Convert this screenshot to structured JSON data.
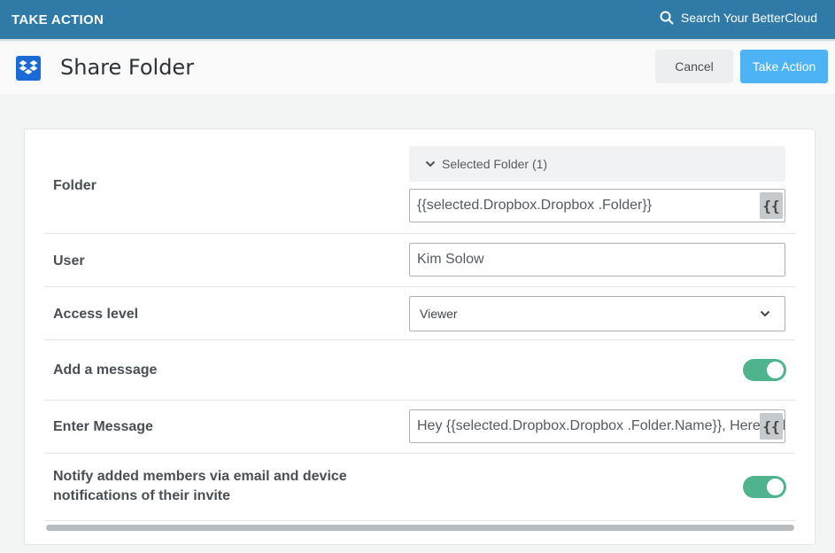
{
  "topbar": {
    "title": "TAKE ACTION",
    "search_label": "Search Your BetterCloud",
    "search_icon": "search-icon"
  },
  "header": {
    "logo_icon": "dropbox-icon",
    "title": "Share Folder",
    "cancel_label": "Cancel",
    "take_action_label": "Take Action"
  },
  "form": {
    "folder": {
      "label": "Folder",
      "selected_header": "Selected Folder (1)",
      "value": "{{selected.Dropbox.Dropbox .Folder}}",
      "variable_button": "{{"
    },
    "user": {
      "label": "User",
      "value": "Kim Solow"
    },
    "access_level": {
      "label": "Access level",
      "value": "Viewer"
    },
    "add_message": {
      "label": "Add a message",
      "enabled": true
    },
    "enter_message": {
      "label": "Enter Message",
      "value": "Hey {{selected.Dropbox.Dropbox .Folder.Name}}, Here is the folder I am sharing with you.",
      "variable_button": "{{"
    },
    "notify": {
      "label_line1": "Notify added members via email and device",
      "label_line2": "notifications of their invite",
      "enabled": true
    }
  },
  "colors": {
    "topbar": "#2f7aa6",
    "primary_button": "#4db3f5",
    "toggle_on": "#4fb38d"
  }
}
